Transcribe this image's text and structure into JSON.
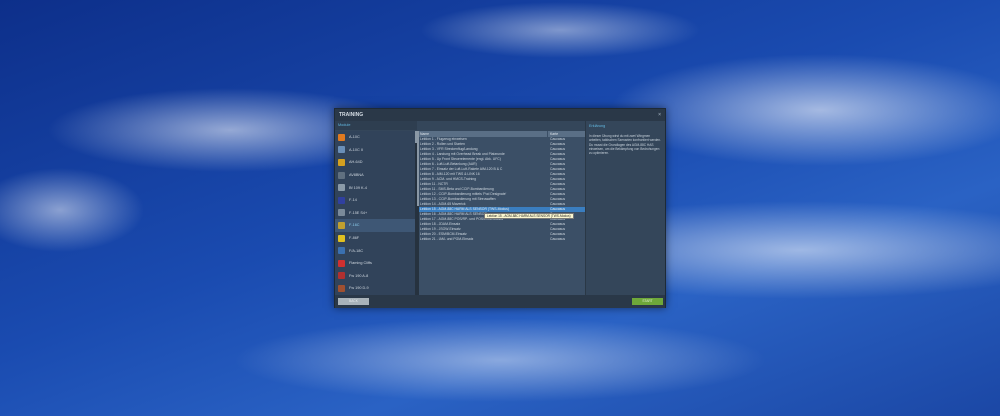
{
  "window": {
    "title": "TRAINING",
    "close": "×"
  },
  "modules": {
    "header": "Module",
    "items": [
      {
        "label": "A-10C",
        "color": "#e07a20"
      },
      {
        "label": "A-10C II",
        "color": "#6a8fb8"
      },
      {
        "label": "AH-64D",
        "color": "#d4a020"
      },
      {
        "label": "AV8BNA",
        "color": "#607080"
      },
      {
        "label": "Bf 109 K-4",
        "color": "#8a9aa8"
      },
      {
        "label": "F-14",
        "color": "#3040a0"
      },
      {
        "label": "F-15E S4+",
        "color": "#7a8a9a"
      },
      {
        "label": "F-16C",
        "color": "#c0a030"
      },
      {
        "label": "F-86F",
        "color": "#e0c020"
      },
      {
        "label": "F/A-18C",
        "color": "#3a70b0"
      },
      {
        "label": "Flaming Cliffs",
        "color": "#d03030"
      },
      {
        "label": "Fw 190 A-8",
        "color": "#b03030"
      },
      {
        "label": "Fw 190 D-9",
        "color": "#a05030"
      }
    ],
    "selected": "F-16C"
  },
  "table": {
    "headers": [
      "Name",
      "Karte"
    ],
    "rows": [
      [
        "Lektion 1 - Flugzeug einweisen",
        "Caucasus"
      ],
      [
        "Lektion 2 - Rollen und Starten",
        "Caucasus"
      ],
      [
        "Lektion 3 - VFR Streckenflug/Landung",
        "Caucasus"
      ],
      [
        "Lektion 4 - Landung mit Overhead Break und Platzrunde",
        "Caucasus"
      ],
      [
        "Lektion 5 - Up Front Steuerelemente (engl. Abk. UFC)",
        "Caucasus"
      ],
      [
        "Lektion 6 - Luft-Luft-Betankung (AAR)",
        "Caucasus"
      ],
      [
        "Lektion 7 - Einsatz der Luft-Luft-Rakete AIM-120 B & C",
        "Caucasus"
      ],
      [
        "Lektion 8 - AIM-120 mit TWS & LINK 16",
        "Caucasus"
      ],
      [
        "Lektion 9 - ACM- und HMCS-Training",
        "Caucasus"
      ],
      [
        "Lektion 11 - NCTR",
        "Caucasus"
      ],
      [
        "Lektion 11 - SMS-Beta und CCIP-Bombardierung",
        "Caucasus"
      ],
      [
        "Lektion 12 - CCIP-Bombardierung mittels 'Pod Designate'",
        "Caucasus"
      ],
      [
        "Lektion 13 - CCIP-Bombardierung mit Streuwaffen",
        "Caucasus"
      ],
      [
        "Lektion 14 - AGM-65 Maverick",
        "Caucasus"
      ],
      [
        "Lektion 15 - AGM-88C HARM ALS SENSOR (TWS-Modus)",
        "Caucasus"
      ],
      [
        "Lektion 16 - AGM-88C HARM ALS SENSOR",
        "Caucasus"
      ],
      [
        "Lektion 17 - AGM-88C POS/RP- und POS/EOM-Modus",
        "Caucasus"
      ],
      [
        "Lektion 18 - JDAM-Einsatz",
        "Caucasus"
      ],
      [
        "Lektion 19 - JSOW-Einsatz",
        "Caucasus"
      ],
      [
        "Lektion 20 - ESM/BCM-Einsatz",
        "Caucasus"
      ],
      [
        "Lektion 21 - IAM- und PGM-Einsatz",
        "Caucasus"
      ]
    ],
    "selected_index": 14,
    "tooltip": "Lektion 15 - AGM-88C HARM ALS SENSOR (TWS-Modus)"
  },
  "description": {
    "title": "Erklärung",
    "text": "In dieser Übung wirst du mit zwei Wingmen arbeiten, taktischen Szenarien konfrontiert werden. Du musst die Grundlagen des AGM-88C HAS einweisen, um die Bekämpfung von Bedrohungen zu optimieren."
  },
  "footer": {
    "back": "BACK",
    "start": "START"
  }
}
